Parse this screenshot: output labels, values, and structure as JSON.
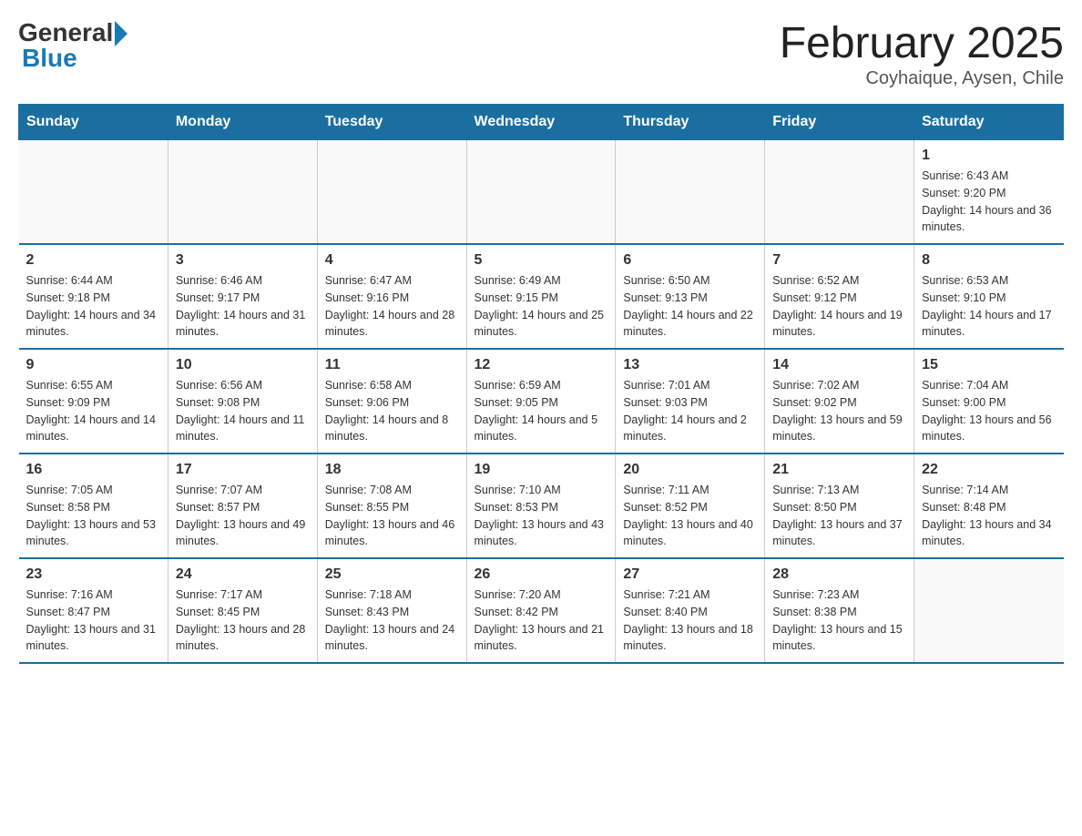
{
  "header": {
    "logo_general": "General",
    "logo_blue": "Blue",
    "month_title": "February 2025",
    "location": "Coyhaique, Aysen, Chile"
  },
  "weekdays": [
    "Sunday",
    "Monday",
    "Tuesday",
    "Wednesday",
    "Thursday",
    "Friday",
    "Saturday"
  ],
  "weeks": [
    [
      {
        "day": "",
        "sunrise": "",
        "sunset": "",
        "daylight": ""
      },
      {
        "day": "",
        "sunrise": "",
        "sunset": "",
        "daylight": ""
      },
      {
        "day": "",
        "sunrise": "",
        "sunset": "",
        "daylight": ""
      },
      {
        "day": "",
        "sunrise": "",
        "sunset": "",
        "daylight": ""
      },
      {
        "day": "",
        "sunrise": "",
        "sunset": "",
        "daylight": ""
      },
      {
        "day": "",
        "sunrise": "",
        "sunset": "",
        "daylight": ""
      },
      {
        "day": "1",
        "sunrise": "Sunrise: 6:43 AM",
        "sunset": "Sunset: 9:20 PM",
        "daylight": "Daylight: 14 hours and 36 minutes."
      }
    ],
    [
      {
        "day": "2",
        "sunrise": "Sunrise: 6:44 AM",
        "sunset": "Sunset: 9:18 PM",
        "daylight": "Daylight: 14 hours and 34 minutes."
      },
      {
        "day": "3",
        "sunrise": "Sunrise: 6:46 AM",
        "sunset": "Sunset: 9:17 PM",
        "daylight": "Daylight: 14 hours and 31 minutes."
      },
      {
        "day": "4",
        "sunrise": "Sunrise: 6:47 AM",
        "sunset": "Sunset: 9:16 PM",
        "daylight": "Daylight: 14 hours and 28 minutes."
      },
      {
        "day": "5",
        "sunrise": "Sunrise: 6:49 AM",
        "sunset": "Sunset: 9:15 PM",
        "daylight": "Daylight: 14 hours and 25 minutes."
      },
      {
        "day": "6",
        "sunrise": "Sunrise: 6:50 AM",
        "sunset": "Sunset: 9:13 PM",
        "daylight": "Daylight: 14 hours and 22 minutes."
      },
      {
        "day": "7",
        "sunrise": "Sunrise: 6:52 AM",
        "sunset": "Sunset: 9:12 PM",
        "daylight": "Daylight: 14 hours and 19 minutes."
      },
      {
        "day": "8",
        "sunrise": "Sunrise: 6:53 AM",
        "sunset": "Sunset: 9:10 PM",
        "daylight": "Daylight: 14 hours and 17 minutes."
      }
    ],
    [
      {
        "day": "9",
        "sunrise": "Sunrise: 6:55 AM",
        "sunset": "Sunset: 9:09 PM",
        "daylight": "Daylight: 14 hours and 14 minutes."
      },
      {
        "day": "10",
        "sunrise": "Sunrise: 6:56 AM",
        "sunset": "Sunset: 9:08 PM",
        "daylight": "Daylight: 14 hours and 11 minutes."
      },
      {
        "day": "11",
        "sunrise": "Sunrise: 6:58 AM",
        "sunset": "Sunset: 9:06 PM",
        "daylight": "Daylight: 14 hours and 8 minutes."
      },
      {
        "day": "12",
        "sunrise": "Sunrise: 6:59 AM",
        "sunset": "Sunset: 9:05 PM",
        "daylight": "Daylight: 14 hours and 5 minutes."
      },
      {
        "day": "13",
        "sunrise": "Sunrise: 7:01 AM",
        "sunset": "Sunset: 9:03 PM",
        "daylight": "Daylight: 14 hours and 2 minutes."
      },
      {
        "day": "14",
        "sunrise": "Sunrise: 7:02 AM",
        "sunset": "Sunset: 9:02 PM",
        "daylight": "Daylight: 13 hours and 59 minutes."
      },
      {
        "day": "15",
        "sunrise": "Sunrise: 7:04 AM",
        "sunset": "Sunset: 9:00 PM",
        "daylight": "Daylight: 13 hours and 56 minutes."
      }
    ],
    [
      {
        "day": "16",
        "sunrise": "Sunrise: 7:05 AM",
        "sunset": "Sunset: 8:58 PM",
        "daylight": "Daylight: 13 hours and 53 minutes."
      },
      {
        "day": "17",
        "sunrise": "Sunrise: 7:07 AM",
        "sunset": "Sunset: 8:57 PM",
        "daylight": "Daylight: 13 hours and 49 minutes."
      },
      {
        "day": "18",
        "sunrise": "Sunrise: 7:08 AM",
        "sunset": "Sunset: 8:55 PM",
        "daylight": "Daylight: 13 hours and 46 minutes."
      },
      {
        "day": "19",
        "sunrise": "Sunrise: 7:10 AM",
        "sunset": "Sunset: 8:53 PM",
        "daylight": "Daylight: 13 hours and 43 minutes."
      },
      {
        "day": "20",
        "sunrise": "Sunrise: 7:11 AM",
        "sunset": "Sunset: 8:52 PM",
        "daylight": "Daylight: 13 hours and 40 minutes."
      },
      {
        "day": "21",
        "sunrise": "Sunrise: 7:13 AM",
        "sunset": "Sunset: 8:50 PM",
        "daylight": "Daylight: 13 hours and 37 minutes."
      },
      {
        "day": "22",
        "sunrise": "Sunrise: 7:14 AM",
        "sunset": "Sunset: 8:48 PM",
        "daylight": "Daylight: 13 hours and 34 minutes."
      }
    ],
    [
      {
        "day": "23",
        "sunrise": "Sunrise: 7:16 AM",
        "sunset": "Sunset: 8:47 PM",
        "daylight": "Daylight: 13 hours and 31 minutes."
      },
      {
        "day": "24",
        "sunrise": "Sunrise: 7:17 AM",
        "sunset": "Sunset: 8:45 PM",
        "daylight": "Daylight: 13 hours and 28 minutes."
      },
      {
        "day": "25",
        "sunrise": "Sunrise: 7:18 AM",
        "sunset": "Sunset: 8:43 PM",
        "daylight": "Daylight: 13 hours and 24 minutes."
      },
      {
        "day": "26",
        "sunrise": "Sunrise: 7:20 AM",
        "sunset": "Sunset: 8:42 PM",
        "daylight": "Daylight: 13 hours and 21 minutes."
      },
      {
        "day": "27",
        "sunrise": "Sunrise: 7:21 AM",
        "sunset": "Sunset: 8:40 PM",
        "daylight": "Daylight: 13 hours and 18 minutes."
      },
      {
        "day": "28",
        "sunrise": "Sunrise: 7:23 AM",
        "sunset": "Sunset: 8:38 PM",
        "daylight": "Daylight: 13 hours and 15 minutes."
      },
      {
        "day": "",
        "sunrise": "",
        "sunset": "",
        "daylight": ""
      }
    ]
  ]
}
